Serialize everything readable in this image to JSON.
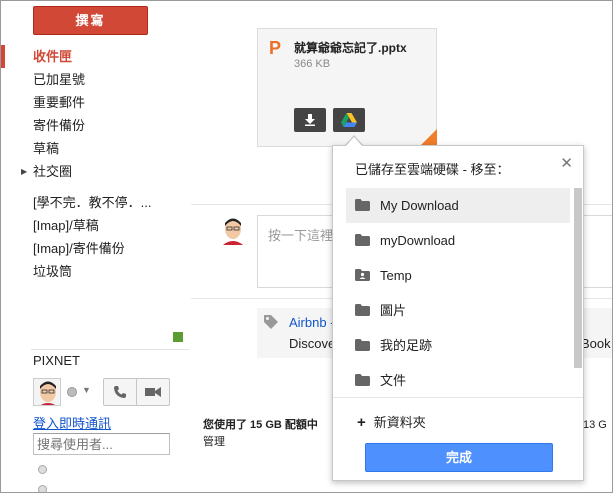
{
  "compose": {
    "label": "撰寫"
  },
  "nav": {
    "inbox": "收件匣",
    "starred": "已加星號",
    "important": "重要郵件",
    "sent": "寄件備份",
    "drafts": "草稿",
    "circles": "社交圈",
    "label1": "[學不完．教不停．...",
    "imap_drafts": "[Imap]/草稿",
    "imap_sent": "[Imap]/寄件備份",
    "trash": "垃圾筒"
  },
  "chat": {
    "account": "PIXNET",
    "signin_link": "登入即時通訊",
    "search_placeholder": "搜尋使用者..."
  },
  "attachment": {
    "name": "就算爺爺忘記了.pptx",
    "size": "366 KB",
    "icon_letter": "P"
  },
  "reply": {
    "placeholder": "按一下這裡"
  },
  "ad": {
    "title": "Airbnb -",
    "desc": "Discove",
    "desc_right": "Book"
  },
  "quota": {
    "text": "您使用了 15 GB 配額中",
    "manage": "管理",
    "right": "13 G"
  },
  "drive_popup": {
    "title": "已儲存至雲端硬碟 - 移至：",
    "folders": [
      {
        "name": "My Download",
        "icon": "folder-icon"
      },
      {
        "name": "myDownload",
        "icon": "folder-icon"
      },
      {
        "name": "Temp",
        "icon": "shared-folder-icon"
      },
      {
        "name": "圖片",
        "icon": "folder-icon"
      },
      {
        "name": "我的足跡",
        "icon": "folder-icon"
      },
      {
        "name": "文件",
        "icon": "folder-icon"
      }
    ],
    "new_folder": "新資料夾",
    "done": "完成"
  },
  "colors": {
    "compose_red": "#d14836",
    "link_blue": "#1155cc",
    "done_blue": "#4d90fe",
    "ppt_orange": "#e8702a",
    "chat_green": "#5a9e33"
  }
}
